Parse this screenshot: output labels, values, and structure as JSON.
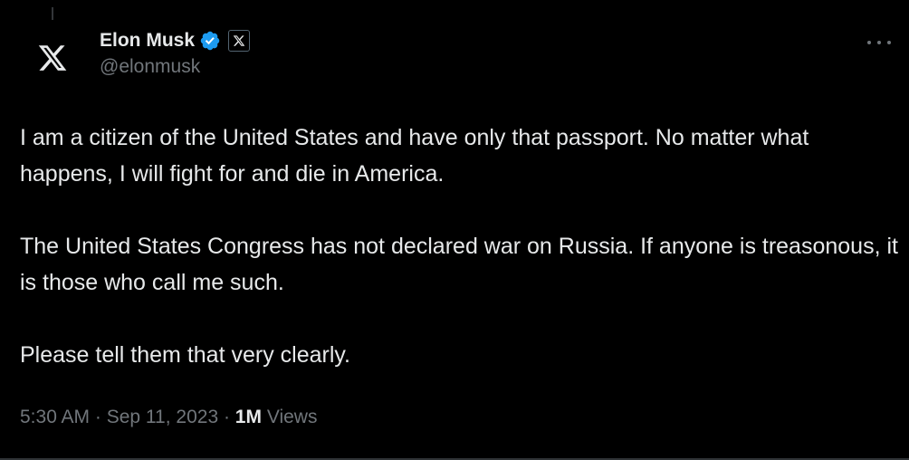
{
  "author": {
    "name": "Elon Musk",
    "handle": "@elonmusk",
    "avatar_icon": "x-logo-icon",
    "verified_icon": "verified-badge-icon",
    "affiliation_icon": "x-affiliation-icon"
  },
  "tweet": {
    "paragraphs": [
      "I am a citizen of the United States and have only that passport. No matter what happens, I will fight for and die in America.",
      "The United States Congress has not declared war on Russia. If anyone is treasonous, it is those who call me such.",
      "Please tell them that very clearly."
    ]
  },
  "meta": {
    "time": "5:30 AM",
    "sep1": " · ",
    "date": "Sep 11, 2023",
    "sep2": " · ",
    "views_count": "1M",
    "views_label": " Views"
  },
  "colors": {
    "background": "#000000",
    "text": "#e7e9ea",
    "secondary": "#71767b",
    "verified": "#1d9bf0"
  }
}
